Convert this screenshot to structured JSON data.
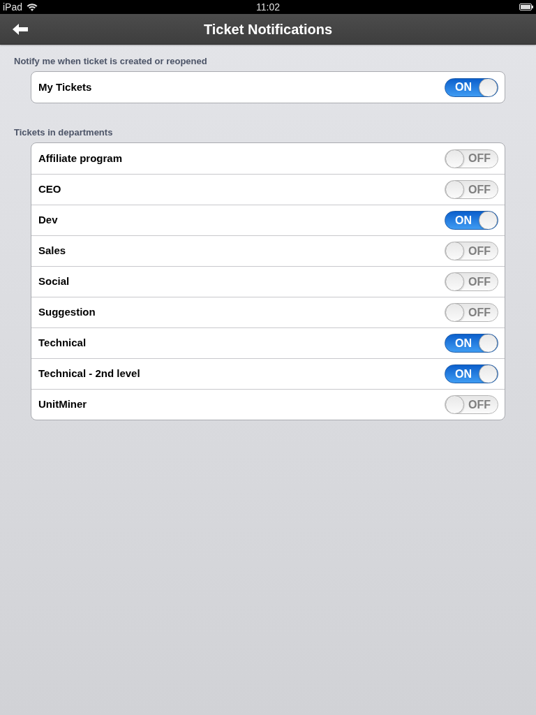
{
  "status_bar": {
    "device": "iPad",
    "time": "11:02"
  },
  "nav_bar": {
    "title": "Ticket Notifications"
  },
  "sections": [
    {
      "header": "Notify me when ticket is created or reopened",
      "rows": [
        {
          "label": "My Tickets",
          "on": true,
          "switch_text": "ON"
        }
      ]
    },
    {
      "header": "Tickets in departments",
      "rows": [
        {
          "label": "Affiliate program",
          "on": false,
          "switch_text": "OFF"
        },
        {
          "label": "CEO",
          "on": false,
          "switch_text": "OFF"
        },
        {
          "label": "Dev",
          "on": true,
          "switch_text": "ON"
        },
        {
          "label": "Sales",
          "on": false,
          "switch_text": "OFF"
        },
        {
          "label": "Social",
          "on": false,
          "switch_text": "OFF"
        },
        {
          "label": "Suggestion",
          "on": false,
          "switch_text": "OFF"
        },
        {
          "label": "Technical",
          "on": true,
          "switch_text": "ON"
        },
        {
          "label": "Technical - 2nd level",
          "on": true,
          "switch_text": "ON"
        },
        {
          "label": "UnitMiner",
          "on": false,
          "switch_text": "OFF"
        }
      ]
    }
  ]
}
